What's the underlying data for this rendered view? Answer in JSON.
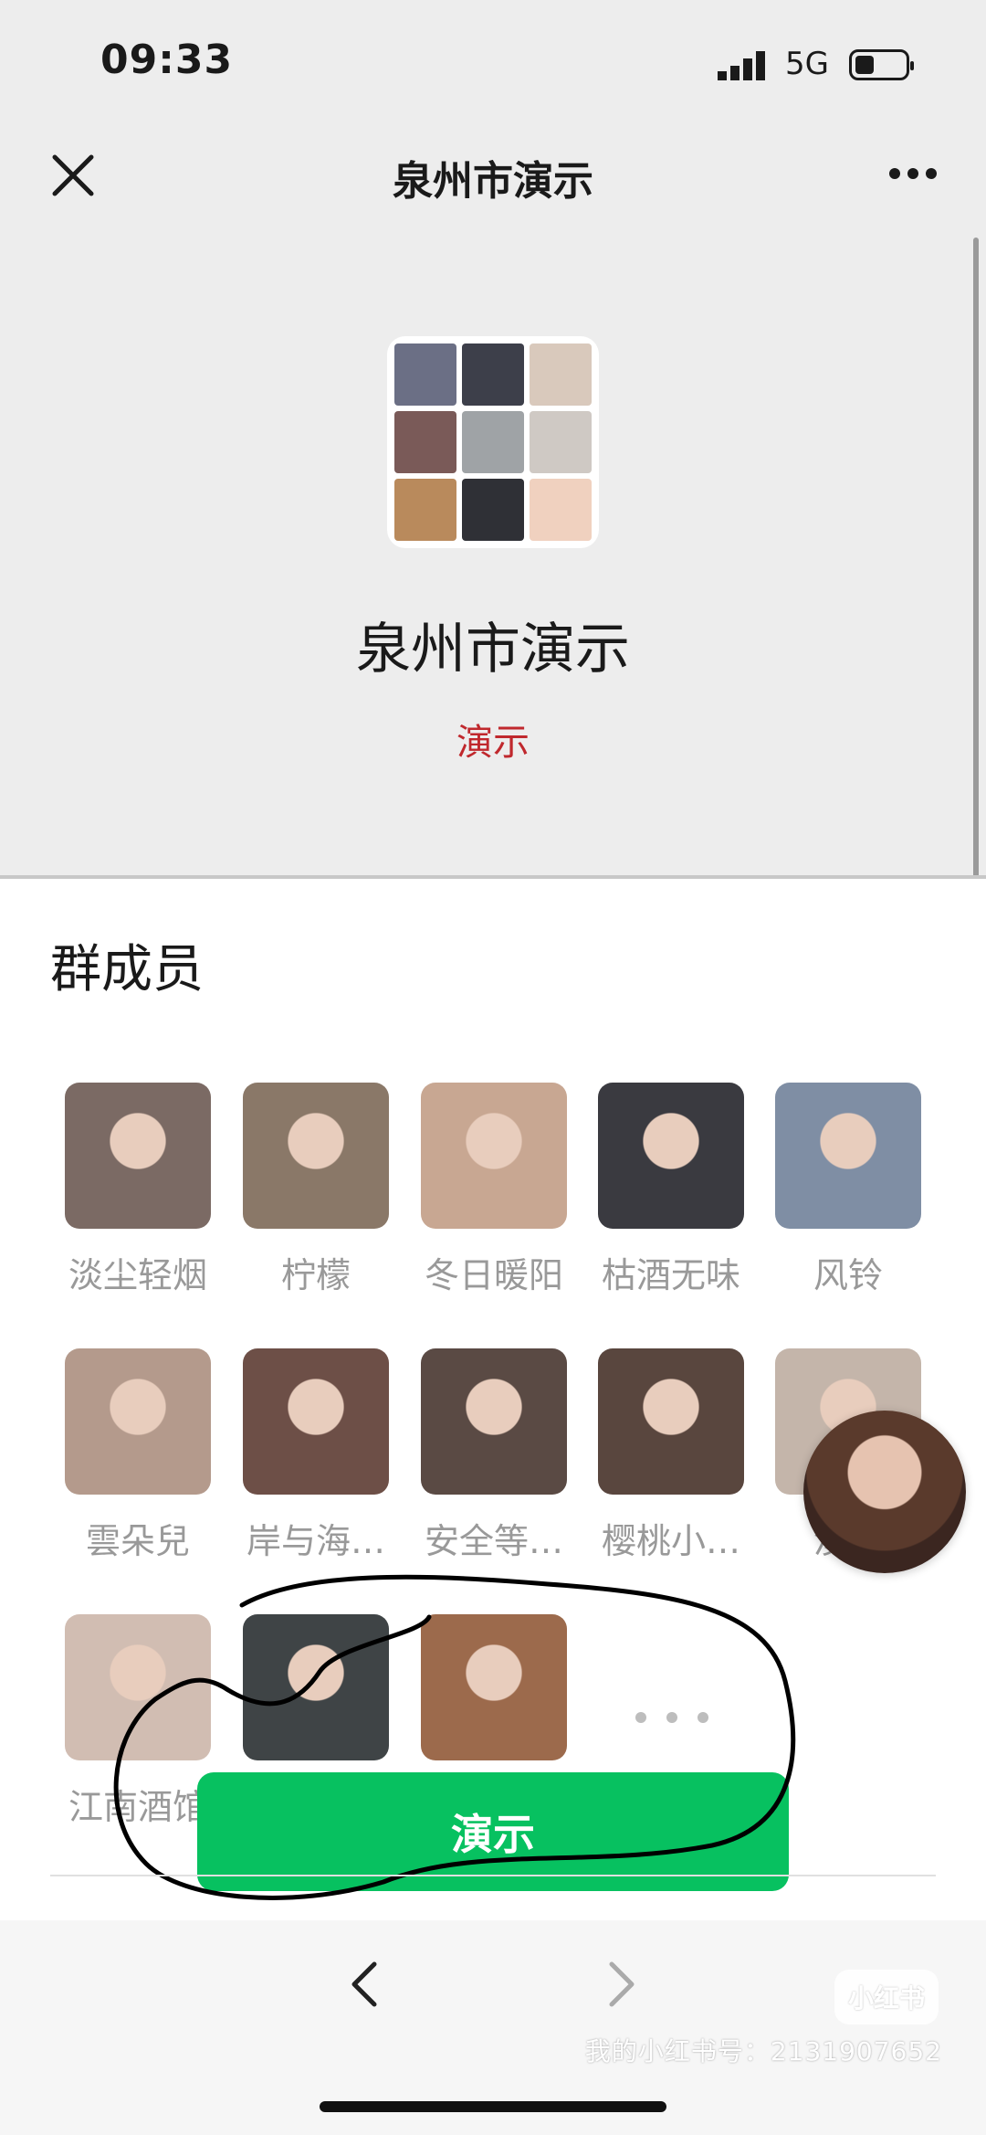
{
  "status_bar": {
    "time": "09:33",
    "network": "5G"
  },
  "nav": {
    "title": "泉州市演示"
  },
  "group": {
    "name": "泉州市演示",
    "subtitle": "演示",
    "avatar_colors": [
      "#6b6f85",
      "#3d3f4a",
      "#d9c9bc",
      "#7a5a58",
      "#9fa3a6",
      "#cfc9c4",
      "#b98a5c",
      "#2f3036",
      "#f0d1bf"
    ]
  },
  "members_section": {
    "title": "群成员",
    "members": [
      {
        "name": "淡尘轻烟",
        "color": "#7b6a64"
      },
      {
        "name": "柠檬",
        "color": "#8a7868"
      },
      {
        "name": "冬日暖阳",
        "color": "#c8a792"
      },
      {
        "name": "枯酒无味",
        "color": "#3a3a40"
      },
      {
        "name": "风铃",
        "color": "#7f8ea4"
      },
      {
        "name": "雲朵兒",
        "color": "#b49a8c"
      },
      {
        "name": "岸与海…",
        "color": "#6d4f47"
      },
      {
        "name": "安全等…",
        "color": "#5a4a44"
      },
      {
        "name": "樱桃小…",
        "color": "#59463e"
      },
      {
        "name": "淡亖",
        "color": "#c4b5aa"
      },
      {
        "name": "江南酒馆",
        "color": "#d1bdb2"
      },
      {
        "name": "",
        "color": "#3f4446"
      },
      {
        "name": "",
        "color": "#9c6a4c"
      }
    ]
  },
  "action": {
    "button_label": "演示"
  },
  "watermark": {
    "logo": "小红书",
    "text": "我的小红书号：2131907652"
  },
  "colors": {
    "accent": "#07c160",
    "subtitle_red": "#c0282d"
  }
}
